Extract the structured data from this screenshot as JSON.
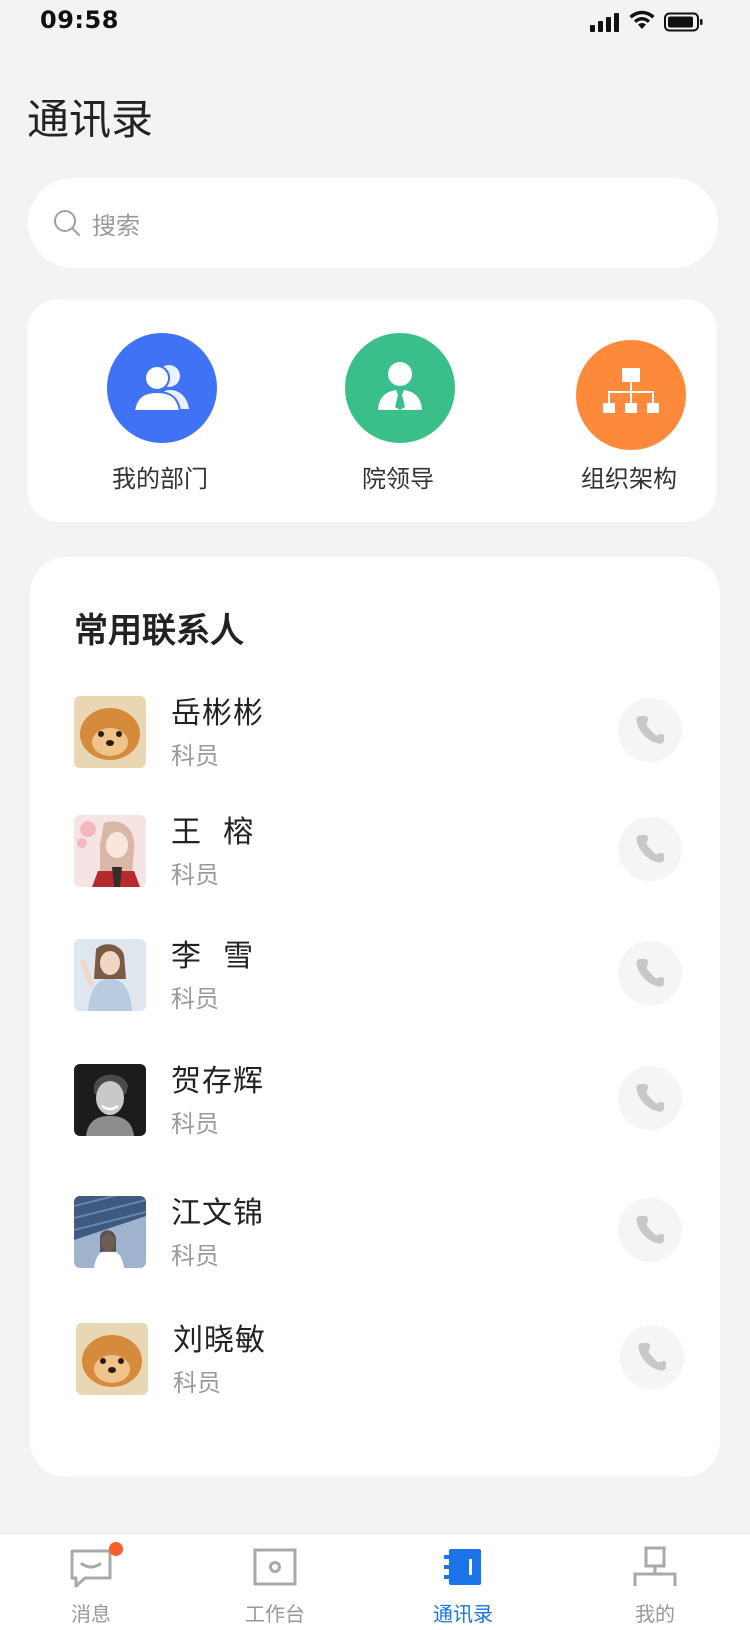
{
  "status_bar": {
    "time": "09:58"
  },
  "page_title": "通讯录",
  "search": {
    "placeholder": "搜索"
  },
  "quick_access": [
    {
      "label": "我的部门",
      "icon": "department-icon",
      "color": "#3f72f5"
    },
    {
      "label": "院领导",
      "icon": "leader-icon",
      "color": "#3abf8b"
    },
    {
      "label": "组织架构",
      "icon": "org-chart-icon",
      "color": "#fd8a3b"
    }
  ],
  "contacts": {
    "title": "常用联系人",
    "items": [
      {
        "name": "岳彬彬",
        "role": "科员",
        "avatar": "pomeranian-dog-avatar"
      },
      {
        "name": "王  榕",
        "role": "科员",
        "avatar": "anime-girl-avatar"
      },
      {
        "name": "李  雪",
        "role": "科员",
        "avatar": "woman-photo-avatar"
      },
      {
        "name": "贺存辉",
        "role": "科员",
        "avatar": "man-bw-photo-avatar"
      },
      {
        "name": "江文锦",
        "role": "科员",
        "avatar": "building-photo-avatar"
      },
      {
        "name": "刘晓敏",
        "role": "科员",
        "avatar": "pomeranian-dog-avatar"
      }
    ]
  },
  "tab_bar": {
    "active": "通讯录",
    "active_color": "#1a73e8",
    "tabs": [
      {
        "label": "消息",
        "icon": "message-icon",
        "badge": true
      },
      {
        "label": "工作台",
        "icon": "workbench-icon",
        "badge": false
      },
      {
        "label": "通讯录",
        "icon": "contacts-book-icon",
        "badge": false
      },
      {
        "label": "我的",
        "icon": "profile-icon",
        "badge": false
      }
    ]
  }
}
